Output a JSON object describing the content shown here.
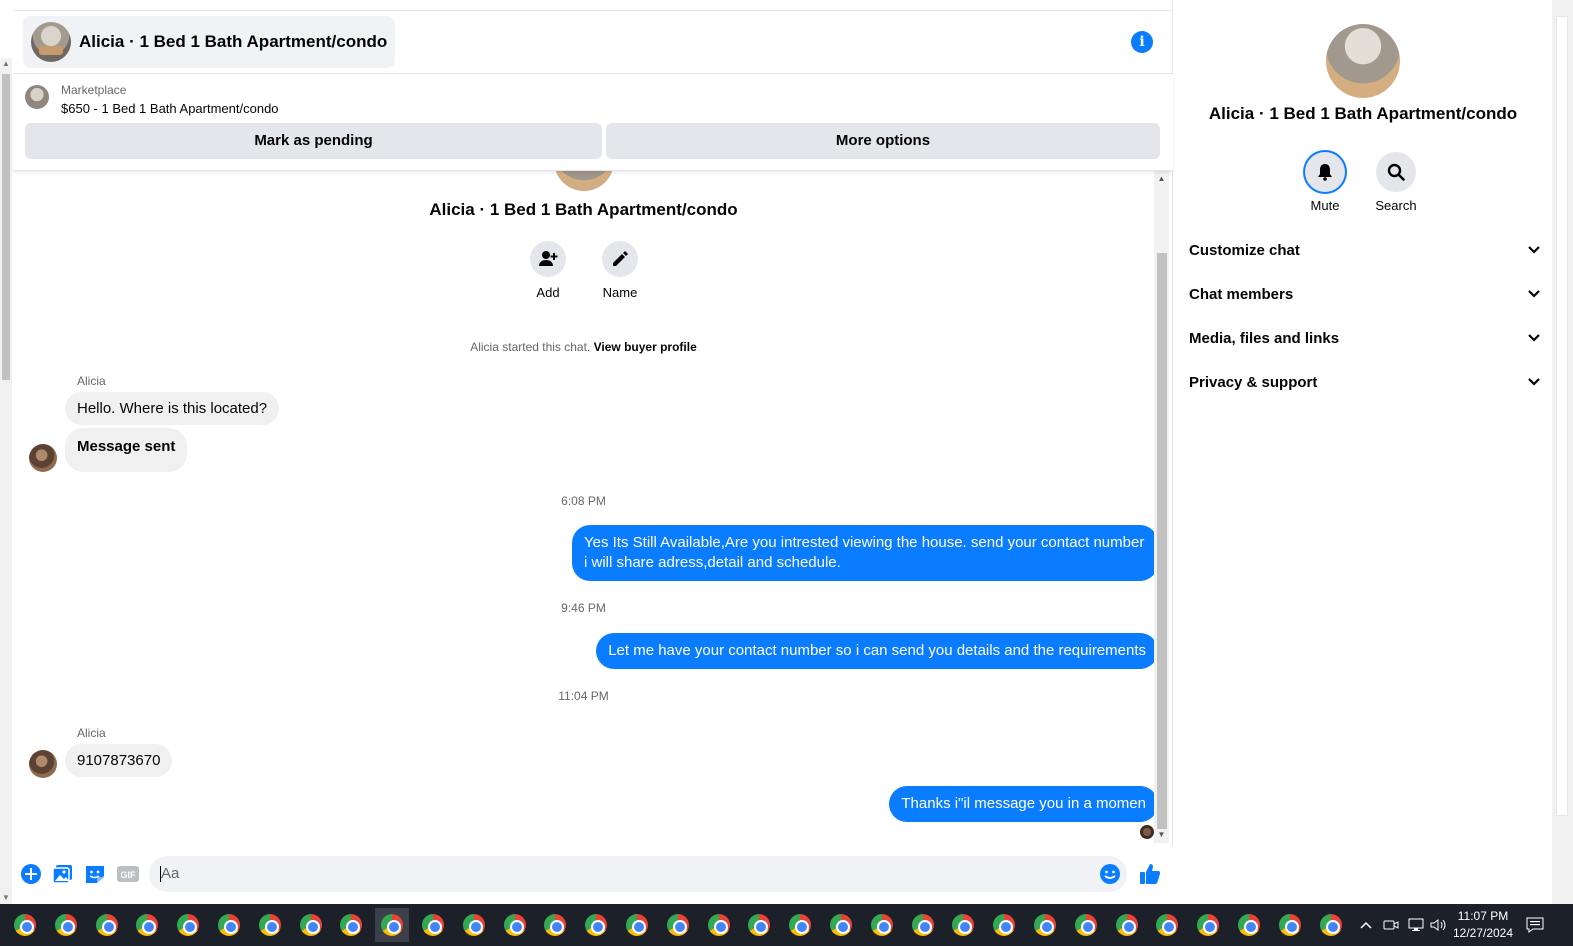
{
  "header": {
    "title": "Alicia · 1 Bed 1 Bath Apartment/condo",
    "info_icon": "info-icon"
  },
  "listing": {
    "source": "Marketplace",
    "price_title": "$650 - 1 Bed 1 Bath Apartment/condo",
    "mark_pending": "Mark as pending",
    "more_options": "More options"
  },
  "intro": {
    "name": "Alicia · 1 Bed 1 Bath Apartment/condo",
    "add_label": "Add",
    "name_label": "Name",
    "started_text": "Alicia started this chat.",
    "view_profile": "View buyer profile"
  },
  "messages": [
    {
      "sender": "Alicia",
      "text": "Hello. Where is this located?"
    },
    {
      "text": "Message sent"
    },
    {
      "time": "6:08 PM"
    },
    {
      "text": "Yes Its Still Available,Are you intrested viewing the house. send your contact number i will share adress,detail and schedule."
    },
    {
      "time": "9:46 PM"
    },
    {
      "text": "Let me have your contact number so i can send you details and the requirements"
    },
    {
      "time": "11:04 PM"
    },
    {
      "sender": "Alicia",
      "text": "9107873670"
    },
    {
      "text": "Thanks i\"il message you in a momen"
    }
  ],
  "composer": {
    "placeholder": "Aa",
    "icons": [
      "plus-icon",
      "photo-icon",
      "sticker-icon",
      "gif-icon",
      "emoji-icon",
      "like-icon"
    ],
    "gif_label": "GIF"
  },
  "sidebar": {
    "name": "Alicia · 1 Bed 1 Bath Apartment/condo",
    "mute_label": "Mute",
    "search_label": "Search",
    "sections": [
      "Customize chat",
      "Chat members",
      "Media, files and links",
      "Privacy & support"
    ]
  },
  "taskbar": {
    "time": "11:07 PM",
    "date": "12/27/2024"
  },
  "colors": {
    "accent": "#0a7cff",
    "bubble_in": "#f0f0f0",
    "taskbar": "#1b2029"
  }
}
